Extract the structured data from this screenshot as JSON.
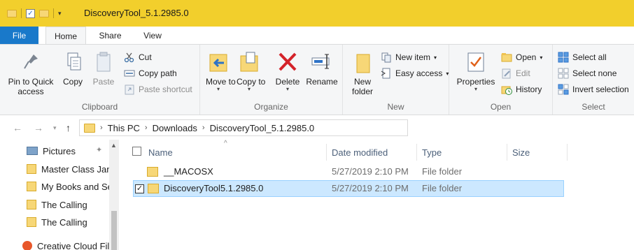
{
  "window": {
    "title": "DiscoveryTool_5.1.2985.0"
  },
  "tabs": {
    "file": "File",
    "home": "Home",
    "share": "Share",
    "view": "View"
  },
  "clipboard": {
    "group": "Clipboard",
    "pin": "Pin to Quick access",
    "copy": "Copy",
    "paste": "Paste",
    "cut": "Cut",
    "copy_path": "Copy path",
    "paste_shortcut": "Paste shortcut"
  },
  "organize": {
    "group": "Organize",
    "move_to": "Move to",
    "copy_to": "Copy to",
    "delete": "Delete",
    "rename": "Rename"
  },
  "new": {
    "group": "New",
    "new_folder": "New folder",
    "new_item": "New item",
    "easy_access": "Easy access"
  },
  "open": {
    "group": "Open",
    "properties": "Properties",
    "open": "Open",
    "edit": "Edit",
    "history": "History"
  },
  "select": {
    "group": "Select",
    "select_all": "Select all",
    "select_none": "Select none",
    "invert": "Invert selection"
  },
  "address": {
    "crumbs": [
      "This PC",
      "Downloads",
      "DiscoveryTool_5.1.2985.0"
    ]
  },
  "nav": {
    "items": [
      "Pictures",
      "Master Class Jan",
      "My Books and Se",
      "The Calling",
      "The Calling",
      "Creative Cloud Fil"
    ]
  },
  "columns": {
    "name": "Name",
    "date": "Date modified",
    "type": "Type",
    "size": "Size"
  },
  "rows": [
    {
      "name": "__MACOSX",
      "date": "5/27/2019 2:10 PM",
      "type": "File folder",
      "size": ""
    },
    {
      "name": "DiscoveryTool5.1.2985.0",
      "date": "5/27/2019 2:10 PM",
      "type": "File folder",
      "size": ""
    }
  ]
}
